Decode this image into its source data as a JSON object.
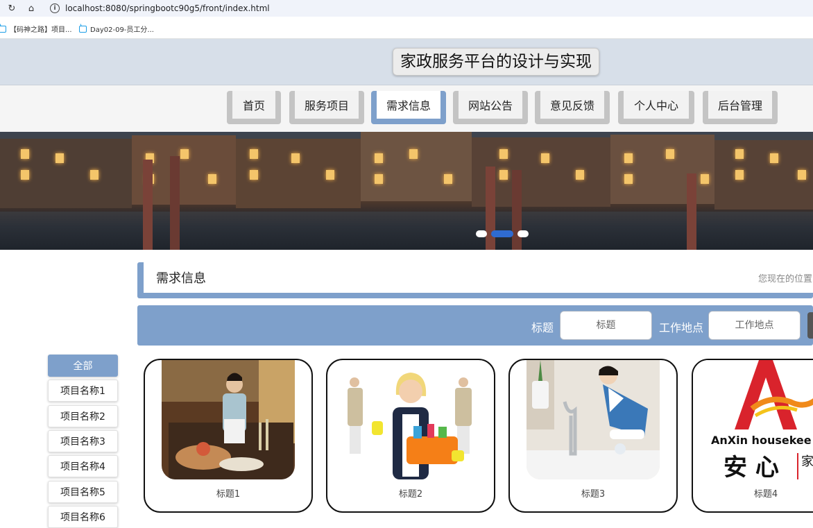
{
  "browser": {
    "url": "localhost:8080/springbootc90g5/front/index.html",
    "bookmarks": [
      {
        "label": "【码神之路】项目..."
      },
      {
        "label": "Day02-09-员工分..."
      }
    ]
  },
  "site": {
    "title": "家政服务平台的设计与实现"
  },
  "nav": {
    "items": [
      {
        "label": "首页"
      },
      {
        "label": "服务项目"
      },
      {
        "label": "需求信息"
      },
      {
        "label": "网站公告"
      },
      {
        "label": "意见反馈"
      },
      {
        "label": "个人中心"
      },
      {
        "label": "后台管理"
      }
    ],
    "active_index": 2
  },
  "banner": {
    "slide_count": 3,
    "active_slide": 1
  },
  "section": {
    "title": "需求信息",
    "location_label": "您现在的位置:"
  },
  "search": {
    "title_label": "标题",
    "title_placeholder": "标题",
    "location_label": "工作地点",
    "location_placeholder": "工作地点"
  },
  "categories": [
    {
      "label": "全部"
    },
    {
      "label": "项目名称1"
    },
    {
      "label": "项目名称2"
    },
    {
      "label": "项目名称3"
    },
    {
      "label": "项目名称4"
    },
    {
      "label": "项目名称5"
    },
    {
      "label": "项目名称6"
    }
  ],
  "cards": [
    {
      "caption": "标题1"
    },
    {
      "caption": "标题2"
    },
    {
      "caption": "标题3"
    },
    {
      "caption": "标题4",
      "logo_text_en": "AnXin housekee",
      "logo_text_cn": "安 心",
      "logo_side": "家政"
    }
  ],
  "colors": {
    "accent": "#7ea0cb",
    "header_bg": "#d7dfe9",
    "nav_tab": "#c4c4c4"
  }
}
